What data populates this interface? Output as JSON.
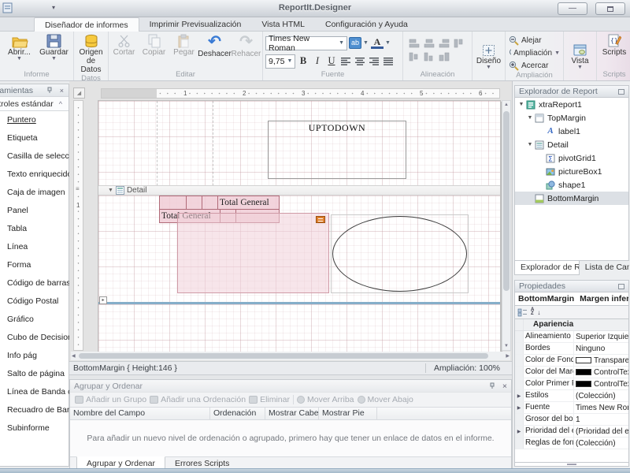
{
  "window": {
    "title": "ReportIt.Designer"
  },
  "ribbon": {
    "tabs": [
      {
        "label": "Diseñador de informes"
      },
      {
        "label": "Imprimir Previsualización"
      },
      {
        "label": "Vista HTML"
      },
      {
        "label": "Configuración y Ayuda"
      }
    ],
    "groups": {
      "informe": {
        "label": "Informe",
        "abrir": "Abrir...",
        "guardar": "Guardar"
      },
      "datos": {
        "label": "Datos",
        "origen": "Origen de Datos"
      },
      "editar": {
        "label": "Editar",
        "cortar": "Cortar",
        "copiar": "Copiar",
        "pegar": "Pegar",
        "deshacer": "Deshacer",
        "rehacer": "Rehacer"
      },
      "fuente": {
        "label": "Fuente",
        "font_name": "Times New Roman",
        "font_size": "9,75",
        "bold": "B",
        "italic": "I",
        "underline": "U"
      },
      "alineacion": {
        "label": "Alineación"
      },
      "diseno": {
        "label": "Diseño"
      },
      "ampliacion": {
        "label": "Ampliación",
        "alejar": "Alejar",
        "ampliacion": "Ampliación",
        "acercar": "Acercar"
      },
      "vista": {
        "label": "Vista"
      },
      "scripts": {
        "label": "Scripts",
        "button": "Scripts"
      }
    }
  },
  "toolbox": {
    "title": "Herramientas",
    "section": "Controles estándar",
    "items": [
      "Puntero",
      "Etiqueta",
      "Casilla de selección",
      "Texto enriquecido",
      "Caja de imagen",
      "Panel",
      "Tabla",
      "Línea",
      "Forma",
      "Código de barras",
      "Código Postal",
      "Gráfico",
      "Cubo de Decisiones",
      "Info pág",
      "Salto de página",
      "Línea de Banda cr...",
      "Recuadro de Band...",
      "Subinforme"
    ]
  },
  "canvas": {
    "ruler_numbers": [
      "1",
      "2",
      "3",
      "4",
      "5",
      "6"
    ],
    "vruler_number": "1",
    "label1_text": "UPTODOWN",
    "detail_band": "Detail",
    "pivot": {
      "total_col": "Total General",
      "total_row": "Total General"
    }
  },
  "statusbar": {
    "left": "BottomMargin { Height:146 }",
    "zoom": "Ampliación: 100%"
  },
  "group_panel": {
    "title": "Agrupar y Ordenar",
    "toolbar": [
      "Añadir un Grupo",
      "Añadir una Ordenación",
      "Eliminar",
      "Mover Arriba",
      "Mover Abajo"
    ],
    "columns": [
      "Nombre del Campo",
      "Ordenación",
      "Mostrar Cabec...",
      "Mostrar Pie"
    ],
    "empty_message": "Para añadir un nuevo nivel de ordenación o agrupado, primero hay que tener un enlace de datos en el informe.",
    "tabs": [
      "Agrupar y Ordenar",
      "Errores Scripts"
    ]
  },
  "explorer": {
    "title": "Explorador de Report",
    "tree": [
      {
        "label": "xtraReport1",
        "icon": "report"
      },
      {
        "label": "TopMargin",
        "icon": "top-margin-band"
      },
      {
        "label": "label1",
        "icon": "label"
      },
      {
        "label": "Detail",
        "icon": "detail-band"
      },
      {
        "label": "pivotGrid1",
        "icon": "pivot-grid"
      },
      {
        "label": "pictureBox1",
        "icon": "picture"
      },
      {
        "label": "shape1",
        "icon": "shape"
      },
      {
        "label": "BottomMargin",
        "icon": "bottom-margin-band"
      }
    ],
    "tabs": [
      "Explorador de Report",
      "Lista de Campo"
    ]
  },
  "properties": {
    "title": "Propiedades",
    "object_name": "BottomMargin",
    "object_desc": "Margen inferior",
    "category": "Apariencia",
    "rows": [
      {
        "name": "Alineamiento de",
        "value": "Superior Izquierdo"
      },
      {
        "name": "Bordes",
        "value": "Ninguno"
      },
      {
        "name": "Color de Fondo",
        "value": "Transparent",
        "swatch": "#ffffff"
      },
      {
        "name": "Color del Marco",
        "value": "ControlText",
        "swatch": "#000000"
      },
      {
        "name": "Color Primer Pla",
        "value": "ControlText",
        "swatch": "#000000"
      },
      {
        "name": "Estilos",
        "value": "(Colección)"
      },
      {
        "name": "Fuente",
        "value": "Times New Roman"
      },
      {
        "name": "Grosor del bord",
        "value": "1"
      },
      {
        "name": "Prioridad del es",
        "value": "(Prioridad del estilo)"
      },
      {
        "name": "Reglas de forma",
        "value": "(Colección)"
      }
    ]
  },
  "colors": {
    "accent_pink": "#f0cdd6",
    "band_separator": "#85aec9",
    "selection": "#dce0e5"
  }
}
